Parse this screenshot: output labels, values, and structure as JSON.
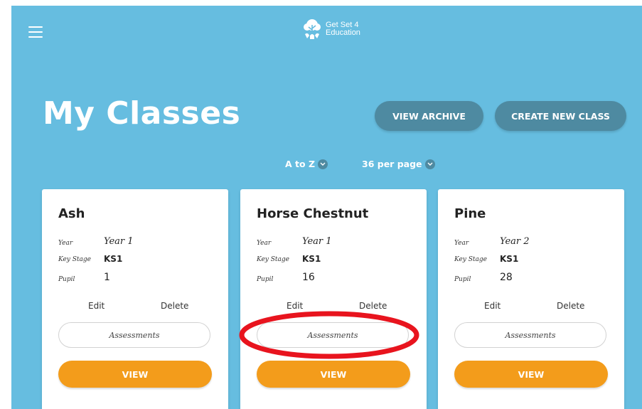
{
  "header": {
    "menu_icon": "hamburger-menu-icon",
    "logo_icon": "tree-logo-icon",
    "logo_line1": "Get Set 4",
    "logo_line2": "Education"
  },
  "page": {
    "title": "My Classes",
    "view_archive_label": "VIEW ARCHIVE",
    "create_class_label": "CREATE NEW CLASS"
  },
  "sort": {
    "order_label": "A to Z",
    "per_page_label": "36 per page",
    "chevron_icon": "chevron-down-icon"
  },
  "field_labels": {
    "year": "Year",
    "key_stage": "Key Stage",
    "pupil": "Pupil"
  },
  "cards": [
    {
      "name": "Ash",
      "year": "Year 1",
      "key_stage": "KS1",
      "pupil": "1",
      "edit": "Edit",
      "delete": "Delete",
      "assessments": "Assessments",
      "view": "VIEW"
    },
    {
      "name": "Horse Chestnut",
      "year": "Year 1",
      "key_stage": "KS1",
      "pupil": "16",
      "edit": "Edit",
      "delete": "Delete",
      "assessments": "Assessments",
      "view": "VIEW"
    },
    {
      "name": "Pine",
      "year": "Year 2",
      "key_stage": "KS1",
      "pupil": "28",
      "edit": "Edit",
      "delete": "Delete",
      "assessments": "Assessments",
      "view": "VIEW"
    }
  ],
  "colors": {
    "background": "#66bde0",
    "dark_button": "#4e8aa1",
    "accent_button": "#f39c1b",
    "annotation": "#e8141e"
  },
  "annotation": {
    "type": "red-ellipse-highlight",
    "target": "Horse Chestnut Assessments button"
  }
}
